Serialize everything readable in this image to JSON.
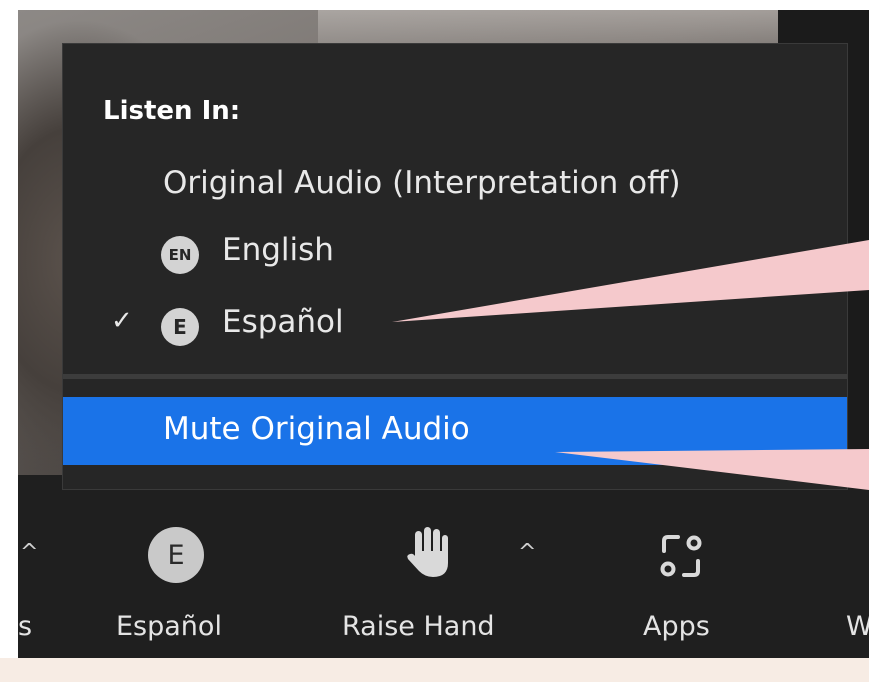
{
  "menu": {
    "header": "Listen In:",
    "items": [
      {
        "label": "Original Audio (Interpretation off)",
        "badge": "",
        "checked": false
      },
      {
        "label": "English",
        "badge": "EN",
        "checked": false
      },
      {
        "label": "Español",
        "badge": "E",
        "checked": true
      }
    ],
    "check_glyph": "✓",
    "mute_label": "Mute Original Audio"
  },
  "toolbar": {
    "partial_left_label": "s",
    "language_badge": "E",
    "language_label": "Español",
    "raise_hand_label": "Raise Hand",
    "apps_label": "Apps",
    "partial_right_label": "W",
    "caret_glyph": "^",
    "icons": [
      "raise-hand-icon",
      "apps-icon",
      "chevron-up-icon"
    ]
  },
  "colors": {
    "menu_bg": "#262626",
    "highlight": "#1a73e8",
    "callout": "#f5c9cc"
  }
}
